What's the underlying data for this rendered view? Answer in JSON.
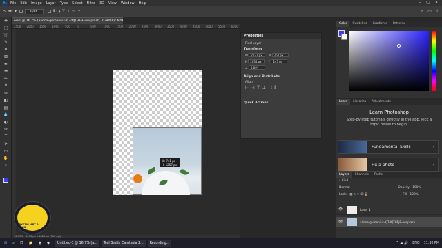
{
  "menu": {
    "logo": "Ps",
    "items": [
      "File",
      "Edit",
      "Image",
      "Layer",
      "Type",
      "Select",
      "Filter",
      "3D",
      "View",
      "Window",
      "Help"
    ]
  },
  "options": {
    "layer_select": "Layer"
  },
  "document": {
    "tab_title": "ed-1 @ 16.7% (aliona-gumeniuk-YJ7dfJTHEjE-unsplash, RGB/8#/CMYK) *"
  },
  "ruler": {
    "ticks": [
      "2500",
      "2000",
      "1500",
      "1000",
      "500",
      "0",
      "500",
      "1000",
      "1500",
      "2000",
      "2500",
      "3000",
      "3500",
      "4000",
      "4500",
      "5000",
      "5500",
      "6000"
    ]
  },
  "tooltip": {
    "w": "W: 741 px",
    "h": "H: 1257 px"
  },
  "properties": {
    "title": "Properties",
    "kind": "Pixel Layer",
    "transform": "Transform",
    "w": "2027 px",
    "x": "262 px",
    "h": "2034 px",
    "y": "243 px",
    "angle": "0.00°",
    "align": "Align and Distribute",
    "align_sub": "Align:",
    "quick": "Quick Actions"
  },
  "color_panel": {
    "tabs": [
      "Color",
      "Swatches",
      "Gradients",
      "Patterns"
    ],
    "fg": "#3c3cff",
    "bg": "#ffffff"
  },
  "learn": {
    "tabs": [
      "Learn",
      "Libraries",
      "Adjustments"
    ],
    "title": "Learn Photoshop",
    "subtitle": "Step-by-step tutorials directly in the app. Pick a topic below to begin.",
    "cards": [
      {
        "label": "Fundamental Skills"
      },
      {
        "label": "Fix a photo"
      }
    ]
  },
  "layers": {
    "tabs": [
      "Layers",
      "Channels",
      "Paths"
    ],
    "kind": "Kind",
    "blend": "Normal",
    "opacity_label": "Opacity:",
    "opacity": "100%",
    "lock_label": "Lock:",
    "fill_label": "Fill:",
    "fill": "100%",
    "items": [
      {
        "name": "Layer 1"
      },
      {
        "name": "aliona-gumeniuk-YJ7dfJTHEjE-unsplash"
      }
    ]
  },
  "status": {
    "zoom": "16.67%",
    "info": "1250 px x 1822 px (300 ppi)"
  },
  "badge": {
    "text": "CRYSTAL ART & FILMS"
  },
  "taskbar": {
    "apps": [
      "Untitled-1 @ 16.7% (a...",
      "TechSmith Camtasia 2...",
      "Recording..."
    ],
    "lang": "ENG",
    "time": "11:30 PM"
  }
}
